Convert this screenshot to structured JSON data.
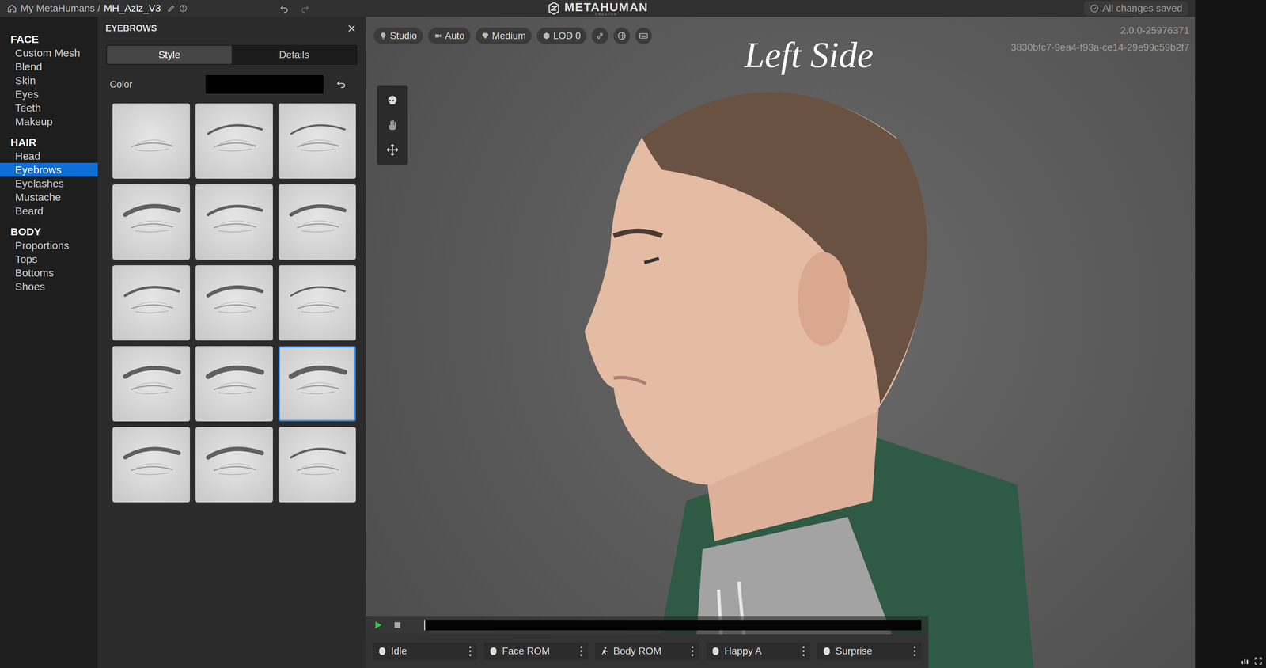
{
  "breadcrumb": {
    "root": "My MetaHumans /",
    "name": "MH_Aziz_V3"
  },
  "logo": {
    "title": "METAHUMAN",
    "subtitle": "CREATOR"
  },
  "save_status": "All changes saved",
  "nav": [
    {
      "header": "FACE",
      "items": [
        {
          "label": "Custom Mesh",
          "selected": false
        },
        {
          "label": "Blend",
          "selected": false
        },
        {
          "label": "Skin",
          "selected": false
        },
        {
          "label": "Eyes",
          "selected": false
        },
        {
          "label": "Teeth",
          "selected": false
        },
        {
          "label": "Makeup",
          "selected": false
        }
      ]
    },
    {
      "header": "HAIR",
      "items": [
        {
          "label": "Head",
          "selected": false
        },
        {
          "label": "Eyebrows",
          "selected": true
        },
        {
          "label": "Eyelashes",
          "selected": false
        },
        {
          "label": "Mustache",
          "selected": false
        },
        {
          "label": "Beard",
          "selected": false
        }
      ]
    },
    {
      "header": "BODY",
      "items": [
        {
          "label": "Proportions",
          "selected": false
        },
        {
          "label": "Tops",
          "selected": false
        },
        {
          "label": "Bottoms",
          "selected": false
        },
        {
          "label": "Shoes",
          "selected": false
        }
      ]
    }
  ],
  "panel": {
    "title": "EYEBROWS",
    "tabs": [
      {
        "label": "Style",
        "selected": true
      },
      {
        "label": "Details",
        "selected": false
      }
    ],
    "color_label": "Color",
    "color": "#000000",
    "styles": [
      {
        "selected": false
      },
      {
        "selected": false
      },
      {
        "selected": false
      },
      {
        "selected": false
      },
      {
        "selected": false
      },
      {
        "selected": false
      },
      {
        "selected": false
      },
      {
        "selected": false
      },
      {
        "selected": false
      },
      {
        "selected": false
      },
      {
        "selected": false
      },
      {
        "selected": true
      },
      {
        "selected": false
      },
      {
        "selected": false
      },
      {
        "selected": false
      }
    ]
  },
  "viewport": {
    "toolbar": [
      {
        "label": "Studio"
      },
      {
        "label": "Auto"
      },
      {
        "label": "Medium"
      },
      {
        "label": "LOD 0"
      }
    ],
    "title": "Left Side",
    "version": "2.0.0-25976371",
    "id": "3830bfc7-9ea4-f93a-ce14-29e99c59b2f7"
  },
  "timeline": {
    "level": 0.0
  },
  "animations": [
    {
      "label": "Idle"
    },
    {
      "label": "Face ROM"
    },
    {
      "label": "Body ROM"
    },
    {
      "label": "Happy A"
    },
    {
      "label": "Surprise"
    }
  ]
}
